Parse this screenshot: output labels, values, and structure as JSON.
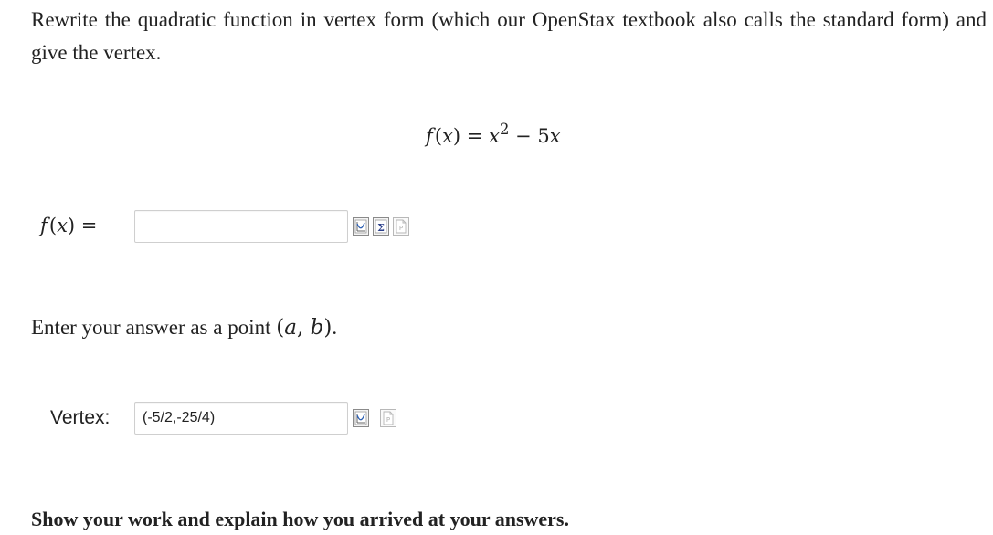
{
  "question": {
    "prompt": "Rewrite the quadratic function in vertex form (which our OpenStax textbook also calls the standard form) and give the vertex."
  },
  "function_display": {
    "lhs_name": "f",
    "lhs_arg": "x",
    "equals": "=",
    "base": "x",
    "exponent": "2",
    "minus": "−",
    "coefficient": "5",
    "term_var": "x"
  },
  "answer1": {
    "lhs_name": "f",
    "lhs_arg": "x",
    "equals": "=",
    "value": "",
    "placeholder": ""
  },
  "instruction": {
    "text": "Enter your answer as a point",
    "point_a": "a",
    "point_b": "b",
    "end": "."
  },
  "vertex": {
    "label": "Vertex:",
    "value": "(-5/2,-25/4)"
  },
  "footer": {
    "show_work": "Show your work and explain how you arrived at your answers."
  },
  "icons": [
    "graph-preview-icon",
    "equation-editor-icon",
    "answer-preview-icon"
  ]
}
